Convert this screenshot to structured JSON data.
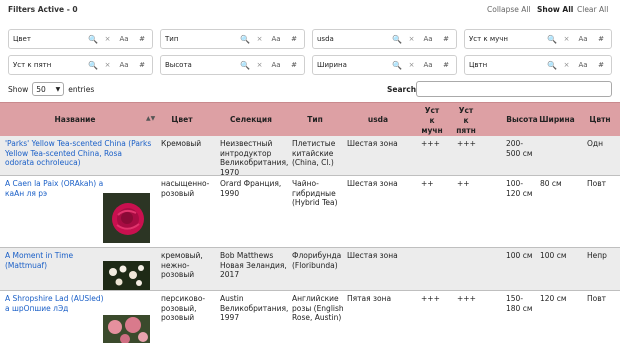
{
  "filters_active": "Filters Active - 0",
  "top_actions": {
    "collapse_all": "Collapse All",
    "show_all": "Show All",
    "clear_all": "Clear All"
  },
  "filters": [
    {
      "label": "Цвет"
    },
    {
      "label": "Тип"
    },
    {
      "label": "usda"
    },
    {
      "label": "Уст к мучн"
    },
    {
      "label": "Уст к пятн"
    },
    {
      "label": "Высота"
    },
    {
      "label": "Ширина"
    },
    {
      "label": "Цвтн"
    }
  ],
  "filter_icons": {
    "search": "🔍",
    "clear": "×",
    "case": "Aa",
    "number": "#",
    "sort": "↕"
  },
  "length": {
    "show": "Show",
    "value": "50",
    "entries": "entries"
  },
  "search": {
    "label": "Search:",
    "value": ""
  },
  "columns": {
    "name": "Название",
    "color": "Цвет",
    "selection": "Селекция",
    "type": "Тип",
    "usda": "usda",
    "mildew_l1": "Уст",
    "mildew_l2": "к",
    "mildew_l3": "мучн",
    "spot_l1": "Уст",
    "spot_l2": "к",
    "spot_l3": "пятн",
    "height": "Высота",
    "width": "Ширина",
    "bloom": "Цвтн"
  },
  "rows": [
    {
      "name": "'Parks' Yellow Tea-scented China (Parks Yellow Tea-scented China, Rosa odorata ochroleuca)",
      "color": "Кремовый",
      "selection": "Неизвестный интродуктор Великобритания, 1970",
      "type": "Плетистые китайские (China, Cl.)",
      "usda": "Шестая зона",
      "mildew": "+++",
      "spot": "+++",
      "height": "200-500 см",
      "width": "",
      "bloom": "Одн"
    },
    {
      "name": "A Caen la Paix (ORAkah) а каАн ля рэ",
      "color": "насыщенно-розовый",
      "selection": "Orard Франция, 1990",
      "type": "Чайно-гибридные (Hybrid Tea)",
      "usda": "Шестая зона",
      "mildew": "++",
      "spot": "++",
      "height": "100-120 см",
      "width": "80 см",
      "bloom": "Повт"
    },
    {
      "name": "A Moment in Time (Mattmuaf)",
      "color": "кремовый, нежно-розовый",
      "selection": "Bob Matthews Новая Зеландия, 2017",
      "type": "Флорибунда (Floribunda)",
      "usda": "Шестая зона",
      "mildew": "",
      "spot": "",
      "height": "100 см",
      "width": "100 см",
      "bloom": "Непр"
    },
    {
      "name": "A Shropshire Lad (AUSled) а шрОпшие лЭд",
      "color": "персиково-розовый, розовый",
      "selection": "Austin Великобритания, 1997",
      "type": "Английские розы (English Rose, Austin)",
      "usda": "Пятая зона",
      "mildew": "+++",
      "spot": "+++",
      "height": "150-180 см",
      "width": "120 см",
      "bloom": "Повт"
    }
  ],
  "colors": {
    "header_bg": "#dda0a4",
    "link": "#1a5fc7",
    "odd_row": "#ececec"
  }
}
